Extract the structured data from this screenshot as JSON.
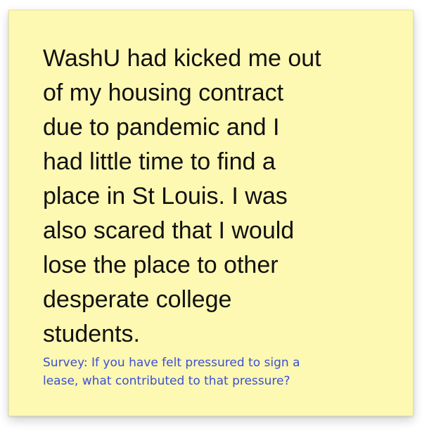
{
  "note": {
    "quote": "WashU had kicked me out\nof my housing contract\ndue to pandemic and I\nhad little time to find a\nplace in St Louis. I was\nalso scared that I would\nlose the place to other\ndesperate college\nstudents.",
    "source": "Survey: If you have felt pressured to sign a\nlease, what contributed to that pressure?"
  },
  "colors": {
    "note_background": "#fdf8b2",
    "quote_text": "#111111",
    "source_text": "#3b4fd6"
  }
}
